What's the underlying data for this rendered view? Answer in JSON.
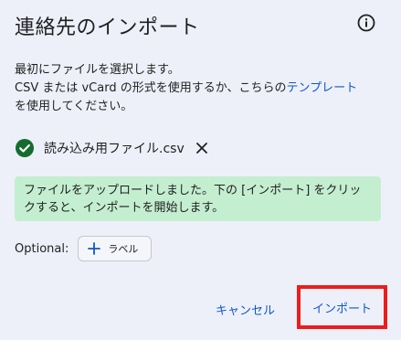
{
  "dialog": {
    "title": "連絡先のインポート",
    "info_icon": "info-icon",
    "description": {
      "line1": "最初にファイルを選択します。",
      "line2_before_link": "CSV または vCard の形式を使用するか、こちらの",
      "link": "テンプレート",
      "line3": "を使用してください。"
    },
    "file": {
      "status_icon": "check-circle-icon",
      "name": "読み込み用ファイル.csv",
      "remove_icon": "close-icon"
    },
    "success_message": "ファイルをアップロードしました。下の [インポート] をクリックすると、インポートを開始します。",
    "optional": {
      "label": "Optional:",
      "chip_icon": "plus-icon",
      "chip_label": "ラベル"
    },
    "buttons": {
      "cancel": "キャンセル",
      "import": "インポート"
    },
    "colors": {
      "background": "#eef0f9",
      "link": "#0b57d0",
      "success_bg": "#c4eed0",
      "check_green": "#146c2e",
      "highlight_red": "#ee1c1c"
    }
  }
}
